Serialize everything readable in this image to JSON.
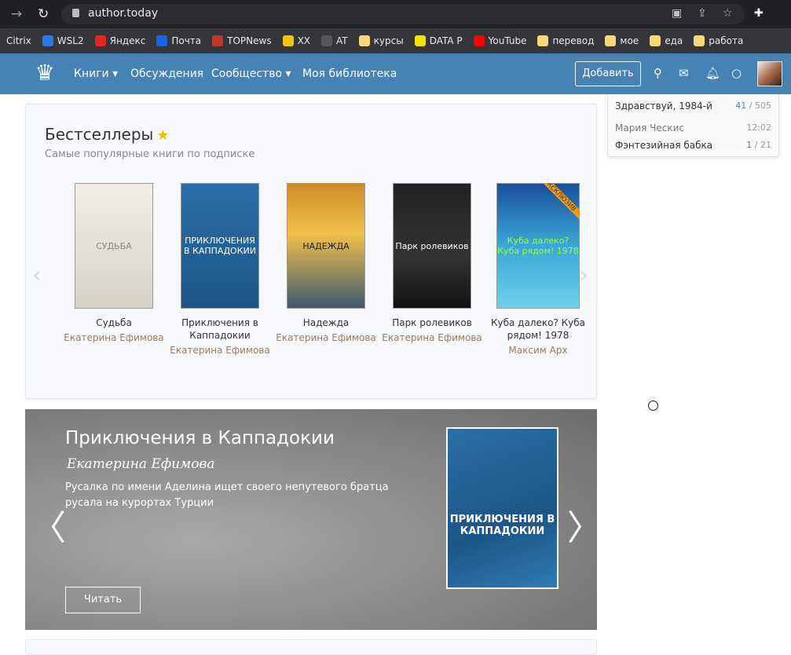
{
  "browser": {
    "url": "author.today",
    "bookmarks": [
      {
        "label": "Citrix",
        "color": ""
      },
      {
        "label": "WSL2",
        "color": "#2a7ae2"
      },
      {
        "label": "Яндекс",
        "color": "#e52620"
      },
      {
        "label": "Почта",
        "color": "#1e62e6"
      },
      {
        "label": "TOPNews",
        "color": "#c0392b"
      },
      {
        "label": "XX",
        "color": "#f1c40f"
      },
      {
        "label": "AT",
        "color": "#555"
      },
      {
        "label": "курсы",
        "color": "#f6d77a"
      },
      {
        "label": "DATA P",
        "color": "#f5e100"
      },
      {
        "label": "YouTube",
        "color": "#ff0000"
      },
      {
        "label": "перевод",
        "color": "#f6d77a"
      },
      {
        "label": "мое",
        "color": "#f6d77a"
      },
      {
        "label": "еда",
        "color": "#f6d77a"
      },
      {
        "label": "работа",
        "color": "#f6d77a"
      }
    ]
  },
  "nav": {
    "books": "Книги",
    "discussions": "Обсуждения",
    "community": "Сообщество",
    "library": "Моя библиотека",
    "add": "Добавить"
  },
  "dropdown": [
    {
      "title": "Здравствуй, 1984-й",
      "count": "41",
      "total": "/ 505"
    },
    {
      "title": "Мария Ческис",
      "count": "12:02",
      "total": ""
    },
    {
      "title": "Фэнтезийная бабка",
      "count": "1",
      "total": "/ 21"
    }
  ],
  "bestsellers": {
    "title": "Бестселлеры",
    "subtitle": "Самые популярные книги по подписке",
    "books": [
      {
        "title": "Судьба",
        "author": "Екатерина Ефимова",
        "cover": "СУДЬБА",
        "bg": "linear-gradient(#f1eee4,#d6d3c8)",
        "fg": "#888"
      },
      {
        "title": "Приключения в Каппадокии",
        "author": "Екатерина Ефимова",
        "cover": "ПРИКЛЮЧЕНИЯ В КАППАДОКИИ",
        "bg": "linear-gradient(#2a6fa8,#1d5587)",
        "fg": "#fff"
      },
      {
        "title": "Надежда",
        "author": "Екатерина Ефимова",
        "cover": "НАДЕЖДА",
        "bg": "linear-gradient(#d08a2a,#f2c04b 40%,#3d5a6e)",
        "fg": "#222"
      },
      {
        "title": "Парк ролевиков",
        "author": "Екатерина Ефимова",
        "cover": "Парк ролевиков",
        "bg": "linear-gradient(#222,#333 60%,#111)",
        "fg": "#fff"
      },
      {
        "title": "Куба далеко? Куба рядом! 1978",
        "author": "Максим Арх",
        "cover": "Куба далеко? Куба рядом! 1978",
        "bg": "linear-gradient(#1a4f9a,#3aa8d8 50%,#6cd0e8)",
        "fg": "#9f3",
        "badge": "ЭКСКЛЮЗИВ"
      }
    ]
  },
  "featured": {
    "title": "Приключения в Каппадокии",
    "author": "Екатерина Ефимова",
    "description": "Русалка по имени Аделина ищет своего непутевого братца русала на курортах Турции",
    "read": "Читать",
    "cover": "ПРИКЛЮЧЕНИЯ В КАППАДОКИИ"
  }
}
